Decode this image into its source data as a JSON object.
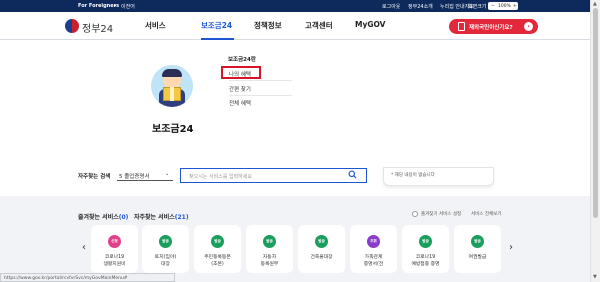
{
  "topbar": {
    "language_label": "For Foreigners",
    "language_caret": "▾",
    "english_label": "이전어",
    "logout": "로그아웃",
    "my_gov24": "정부24소개",
    "site_guide": "누리집 안내지도",
    "zoom_label": "화면크기",
    "zoom_minus": "−",
    "zoom_value": "100%",
    "zoom_plus": "+"
  },
  "header": {
    "logo_text": "정부24",
    "nav": [
      {
        "label": "서비스"
      },
      {
        "label": "보조금24"
      },
      {
        "label": "정책정보"
      },
      {
        "label": "고객센터"
      },
      {
        "label": "MyGOV"
      }
    ],
    "cta_label": "재외국민이신가요?",
    "cta_arrow": "›"
  },
  "mega_menu": {
    "title": "보조금24",
    "submenu_header": "보조금24란",
    "submenu_items": [
      "나의 혜택",
      "간편 찾기",
      "전체 혜택"
    ],
    "highlighted_index": 0
  },
  "search": {
    "label": "자주찾는 검색",
    "select_value": "5 졸업증명서",
    "select_caret": "⌄",
    "placeholder": "찾으시는 서비스를 입력하세요",
    "notice": "* 해당 내용이 없습니다"
  },
  "favorites": {
    "tab1_label": "즐겨찾는 서비스",
    "tab1_count": "(0)",
    "tab2_label": "자주찾는 서비스",
    "tab2_count": "(21)",
    "setting_label": "즐겨찾기 서비스 설정",
    "view_all": "서비스 전체보기",
    "prev_arrow": "‹",
    "next_arrow": "›",
    "cards": [
      {
        "badge": "신청",
        "badge_color": "#e0418a",
        "line1": "코로나19",
        "line2": "생활지원비"
      },
      {
        "badge": "발급",
        "badge_color": "#1a9e5b",
        "line1": "토지(임야)",
        "line2": "대장"
      },
      {
        "badge": "발급",
        "badge_color": "#1a9e5b",
        "line1": "주민등록등본",
        "line2": "(초본)"
      },
      {
        "badge": "발급",
        "badge_color": "#1a9e5b",
        "line1": "자동차",
        "line2": "등록원부"
      },
      {
        "badge": "발급",
        "badge_color": "#1a9e5b",
        "line1": "건축물대장",
        "line2": ""
      },
      {
        "badge": "조회",
        "badge_color": "#8a3cc9",
        "line1": "가족관계",
        "line2": "증명서(전"
      },
      {
        "badge": "발급",
        "badge_color": "#1a9e5b",
        "line1": "코로나19",
        "line2": "예방접종 증명"
      },
      {
        "badge": "발급",
        "badge_color": "#1a9e5b",
        "line1": "여권발급",
        "line2": ""
      }
    ]
  },
  "status_bar": {
    "url": "https://www.gov.kr/portal/rcvfvrSvc/myGovMainMenu#"
  },
  "colors": {
    "topbar_bg": "#0e2a5c",
    "accent": "#1d55d6",
    "cta": "#e3283c",
    "highlight": "#d8142a"
  }
}
